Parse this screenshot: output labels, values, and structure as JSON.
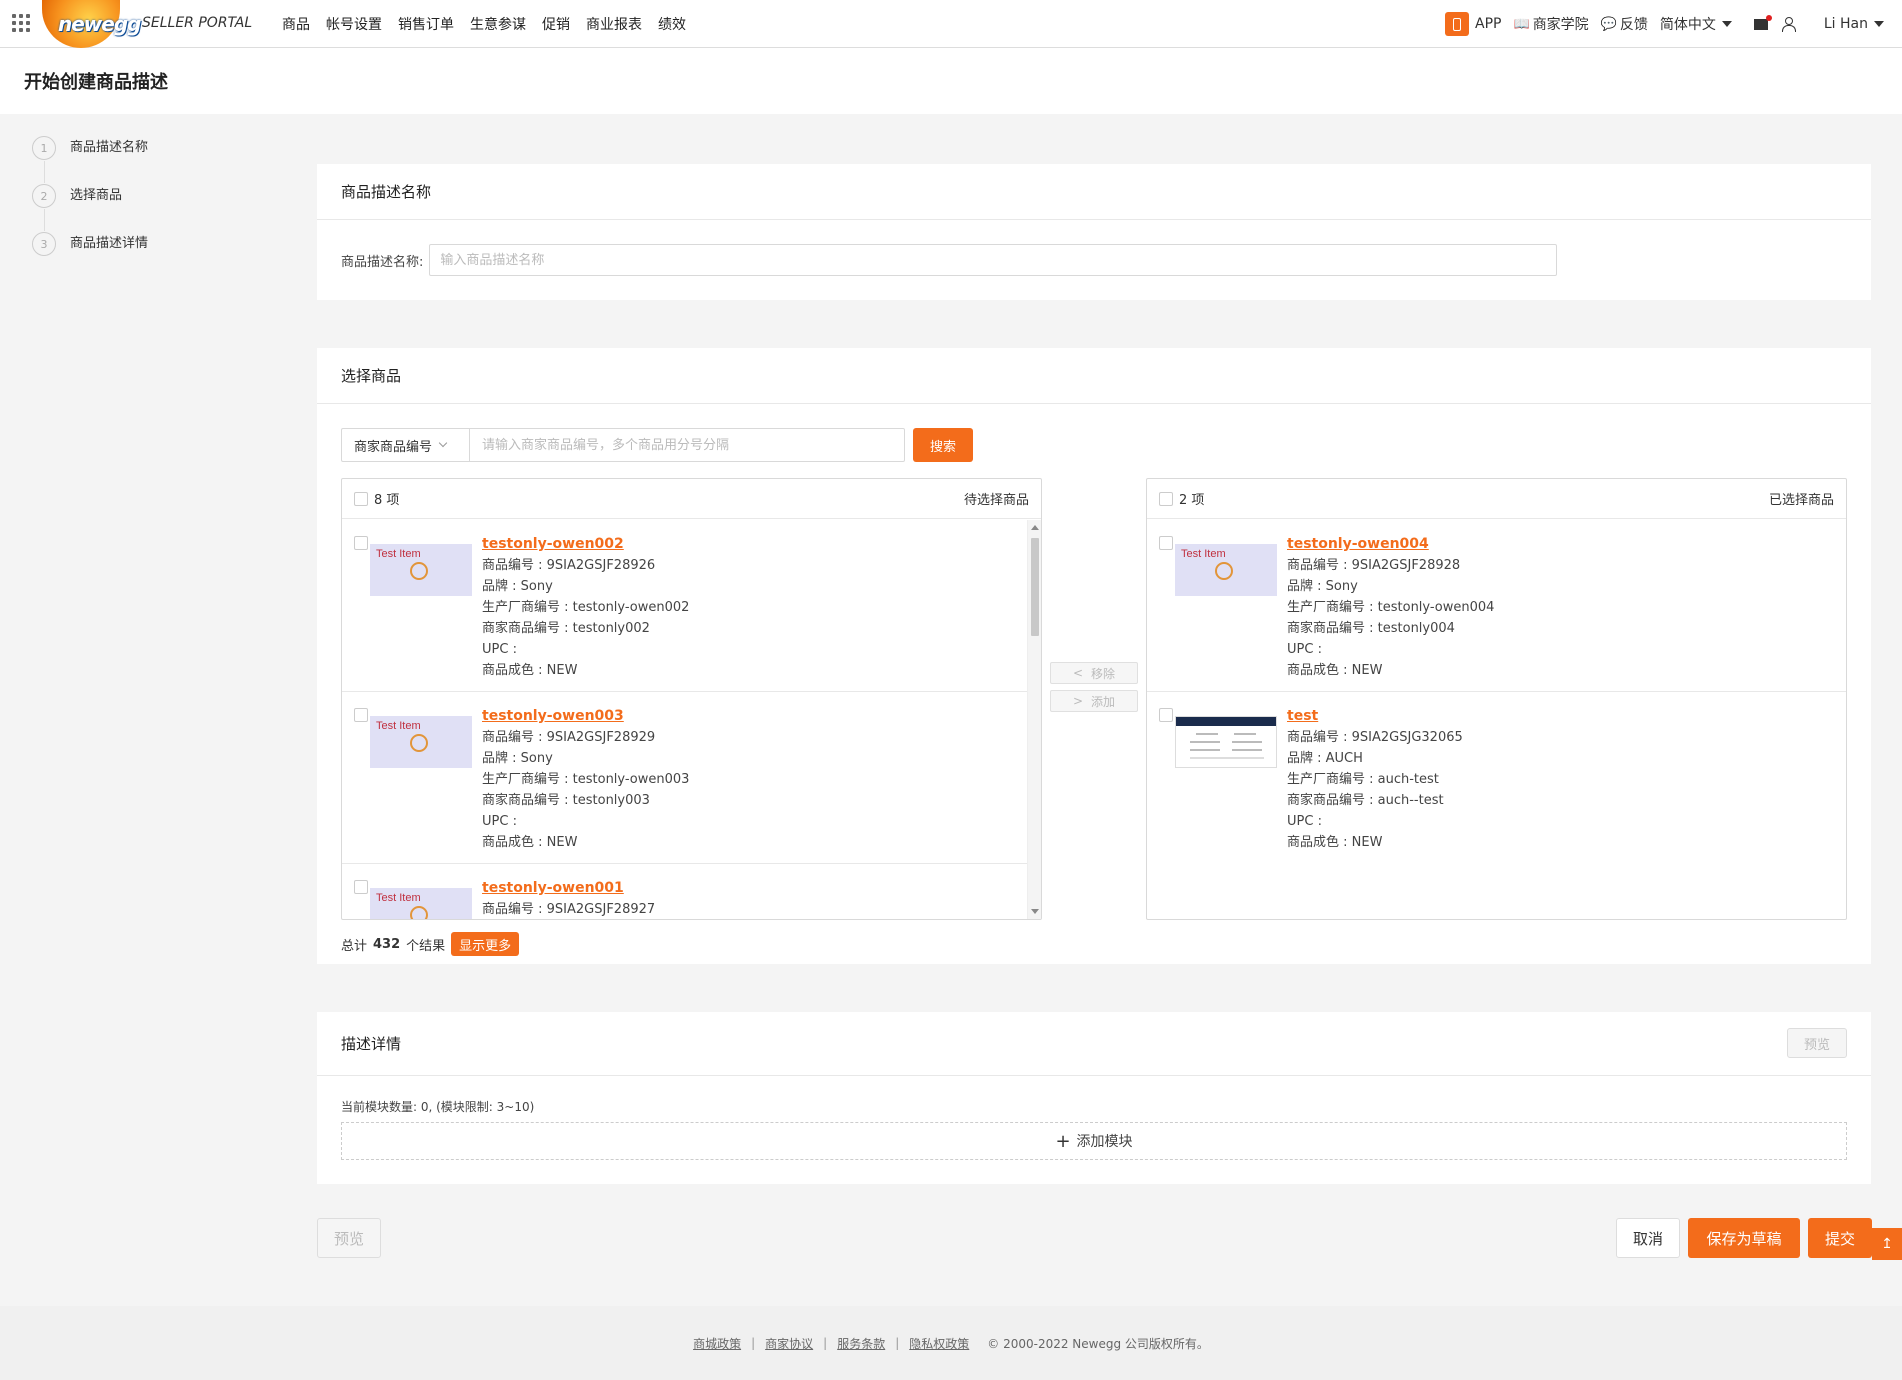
{
  "header": {
    "logo_text": "newegg",
    "portal_name": "SELLER PORTAL",
    "nav": [
      "商品",
      "帐号设置",
      "销售订单",
      "生意参谋",
      "促销",
      "商业报表",
      "绩效"
    ],
    "app_label": "APP",
    "academy_label": "商家学院",
    "feedback_label": "反馈",
    "language": "简体中文",
    "user_name": "Li Han"
  },
  "page": {
    "title": "开始创建商品描述"
  },
  "steps": [
    {
      "num": "1",
      "label": "商品描述名称"
    },
    {
      "num": "2",
      "label": "选择商品"
    },
    {
      "num": "3",
      "label": "商品描述详情"
    }
  ],
  "name_section": {
    "title": "商品描述名称",
    "field_label": "商品描述名称:",
    "placeholder": "输入商品描述名称"
  },
  "select_section": {
    "title": "选择商品",
    "search_type": "商家商品编号",
    "search_placeholder": "请输入商家商品编号，多个商品用分号分隔",
    "search_button": "搜索",
    "left_count": "8 项",
    "left_title": "待选择商品",
    "right_count": "2 项",
    "right_title": "已选择商品",
    "remove_label": "移除",
    "add_label": "添加",
    "totals_prefix": "总计",
    "totals_count": "432",
    "totals_suffix": "个结果",
    "show_more": "显示更多",
    "thumb_label": "Test Item",
    "left_items": [
      {
        "title": "testonly-owen002",
        "item_no": "商品编号 : 9SIA2GSJF28926",
        "brand": "品牌 : Sony",
        "mfr": "生产厂商编号 : testonly-owen002",
        "seller": "商家商品编号 : testonly002",
        "upc": "UPC :",
        "cond": "商品成色 : NEW"
      },
      {
        "title": "testonly-owen003",
        "item_no": "商品编号 : 9SIA2GSJF28929",
        "brand": "品牌 : Sony",
        "mfr": "生产厂商编号 : testonly-owen003",
        "seller": "商家商品编号 : testonly003",
        "upc": "UPC :",
        "cond": "商品成色 : NEW"
      },
      {
        "title": "testonly-owen001",
        "item_no": "商品编号 : 9SIA2GSJF28927",
        "brand": "",
        "mfr": "",
        "seller": "",
        "upc": "",
        "cond": ""
      }
    ],
    "right_items": [
      {
        "title": "testonly-owen004",
        "item_no": "商品编号 : 9SIA2GSJF28928",
        "brand": "品牌 : Sony",
        "mfr": "生产厂商编号 : testonly-owen004",
        "seller": "商家商品编号 : testonly004",
        "upc": "UPC :",
        "cond": "商品成色 : NEW"
      },
      {
        "title": "test",
        "item_no": "商品编号 : 9SIA2GSJG32065",
        "brand": "品牌 : AUCH",
        "mfr": "生产厂商编号 : auch-test",
        "seller": "商家商品编号 : auch--test",
        "upc": "UPC :",
        "cond": "商品成色 : NEW"
      }
    ]
  },
  "detail_section": {
    "title": "描述详情",
    "preview_label": "预览",
    "module_hint": "当前模块数量: 0, (模块限制: 3~10)",
    "add_module": "添加模块"
  },
  "actions": {
    "preview": "预览",
    "cancel": "取消",
    "save_draft": "保存为草稿",
    "submit": "提交"
  },
  "footer": {
    "links": [
      "商城政策",
      "商家协议",
      "服务条款",
      "隐私权政策"
    ],
    "copyright": "© 2000-2022 Newegg 公司版权所有。"
  },
  "colors": {
    "accent": "#f36c1b",
    "link": "#f36c1b"
  }
}
